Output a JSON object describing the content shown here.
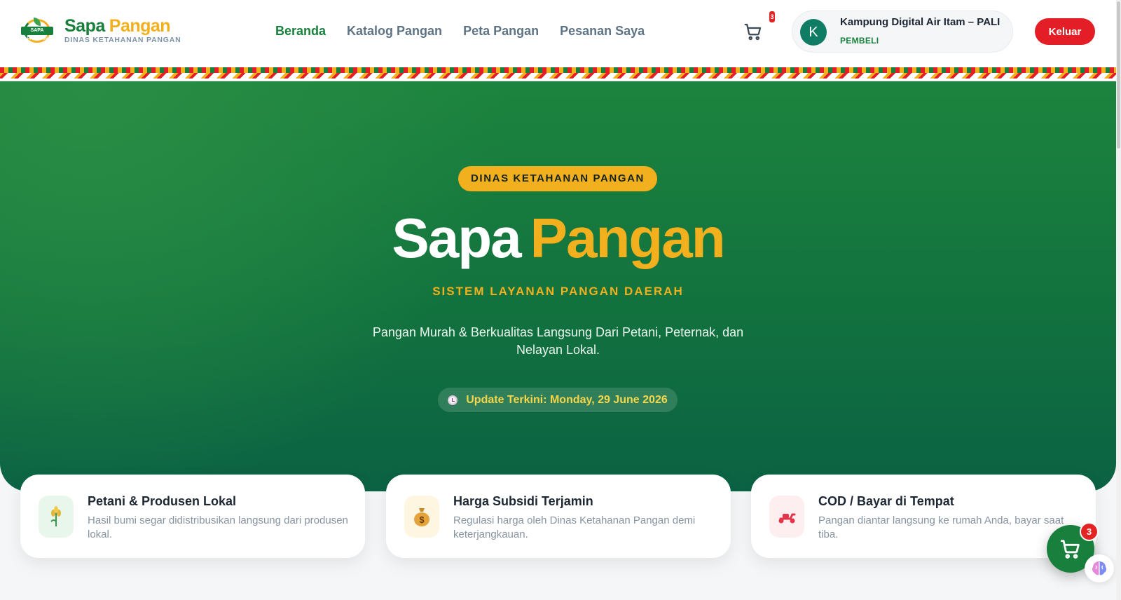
{
  "brand": {
    "logo_badge_text": "SAPA PANGAN",
    "title_part1": "Sapa",
    "title_part2": "Pangan",
    "subtitle": "DINAS KETAHANAN PANGAN"
  },
  "nav": {
    "items": [
      {
        "label": "Beranda",
        "active": true
      },
      {
        "label": "Katalog Pangan",
        "active": false
      },
      {
        "label": "Peta Pangan",
        "active": false
      },
      {
        "label": "Pesanan Saya",
        "active": false
      }
    ]
  },
  "cart": {
    "icon": "cart-icon",
    "count": "3"
  },
  "user": {
    "initial": "K",
    "name": "Kampung Digital Air Itam – PALI",
    "role": "PEMBELI"
  },
  "logout_label": "Keluar",
  "hero": {
    "badge": "DINAS KETAHANAN PANGAN",
    "title_part1": "Sapa",
    "title_part2": "Pangan",
    "subtitle": "SISTEM LAYANAN PANGAN DAERAH",
    "description": "Pangan Murah & Berkualitas Langsung Dari Petani, Peternak, dan Nelayan Lokal.",
    "update_label": "Update Terkini: Monday, 29 June 2026"
  },
  "features": [
    {
      "icon": "wheat-icon",
      "title": "Petani & Produsen Lokal",
      "desc": "Hasil bumi segar didistribusikan langsung dari produsen lokal."
    },
    {
      "icon": "money-bag-icon",
      "title": "Harga Subsidi Terjamin",
      "desc": "Regulasi harga oleh Dinas Ketahanan Pangan demi keterjangkauan."
    },
    {
      "icon": "scooter-icon",
      "title": "COD / Bayar di Tempat",
      "desc": "Pangan diantar langsung ke rumah Anda, bayar saat tiba."
    }
  ],
  "floating_cart": {
    "count": "3"
  },
  "colors": {
    "primary_green": "#18803c",
    "accent_yellow": "#f2b01e",
    "danger_red": "#e31e26"
  }
}
